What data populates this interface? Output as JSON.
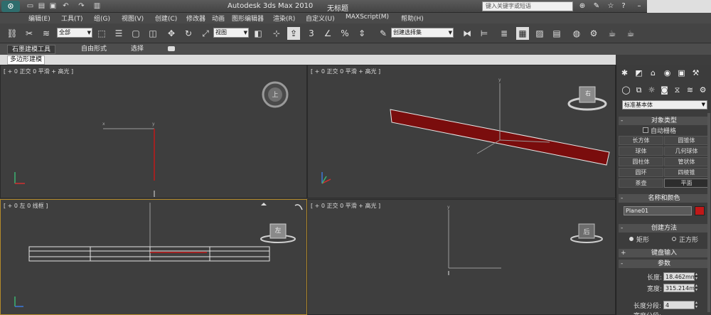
{
  "app": {
    "title": "Autodesk 3ds Max  2010",
    "subtitle": "无标题"
  },
  "search": {
    "placeholder": "键入关键字或短语"
  },
  "menus": [
    "编辑(E)",
    "工具(T)",
    "组(G)",
    "视图(V)",
    "创建(C)",
    "修改器",
    "动画",
    "图形编辑器",
    "渲染(R)",
    "自定义(U)",
    "MAXScript(M)",
    "帮助(H)"
  ],
  "toolbar": {
    "selection_filter": "全部",
    "ref_coord": "视图",
    "named_selection": "创建选择集",
    "snap_value": "3"
  },
  "ribbon": {
    "tabs": [
      "石墨建模工具",
      "自由形式",
      "选择"
    ],
    "subtab": "多边形建模"
  },
  "viewports": {
    "top": {
      "label": "[ + 0 正交 0 平滑 + 高光 ]",
      "cube": "上"
    },
    "persp": {
      "label": "[ + 0 正交 0 平滑 + 高光 ]",
      "cube": "右"
    },
    "left": {
      "label": "[ + 0 左 0 线框 ]",
      "cube": "左"
    },
    "front": {
      "label": "[ + 0 正交 0 平滑 + 高光 ]",
      "cube": "后"
    }
  },
  "panel": {
    "category": "标准基本体",
    "object_type": {
      "title": "对象类型",
      "autogrid": "自动栅格",
      "buttons": [
        "长方体",
        "圆锥体",
        "球体",
        "几何球体",
        "圆柱体",
        "管状体",
        "圆环",
        "四棱锥",
        "茶壶",
        "平面"
      ],
      "selected": "平面"
    },
    "name_color": {
      "title": "名称和颜色",
      "name": "Plane01",
      "color": "#c01818"
    },
    "creation": {
      "title": "创建方法",
      "option1": "矩形",
      "option2": "正方形"
    },
    "keyboard": {
      "title": "键盘输入"
    },
    "params": {
      "title": "参数",
      "length_label": "长度:",
      "length": "18.462mm",
      "width_label": "宽度:",
      "width": "315.214m",
      "lseg_label": "长度分段:",
      "lseg": "4",
      "wseg_label": "宽度分段:"
    }
  },
  "colors": {
    "plane": "#7a0d0d",
    "accent": "#c01818"
  }
}
